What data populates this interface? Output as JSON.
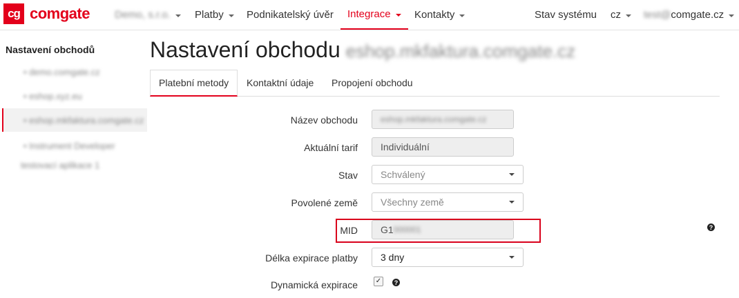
{
  "brand": {
    "logo_mark": "cg",
    "name": "comgate"
  },
  "navbar": {
    "company": "Demo, s.r.o.",
    "items": [
      "Platby",
      "Podnikatelský úvěr",
      "Integrace",
      "Kontakty"
    ],
    "active": "Integrace",
    "status": "Stav systému",
    "language": "cz",
    "user_prefix": "test@",
    "user_domain": "comgate.cz"
  },
  "sidebar": {
    "title": "Nastavení obchodů",
    "items": [
      "• demo.comgate.cz",
      "• eshop.xyz.eu",
      "• eshop.mkfaktura.comgate.cz",
      "• Instrument Developer",
      "  testovací aplikace 1"
    ]
  },
  "page": {
    "title": "Nastavení obchodu",
    "title_suffix": "eshop.mkfaktura.comgate.cz"
  },
  "tabs": [
    "Platební metody",
    "Kontaktní údaje",
    "Propojení obchodu"
  ],
  "form": {
    "shop_name_label": "Název obchodu",
    "shop_name_value": "eshop.mkfaktura.comgate.cz",
    "tariff_label": "Aktuální tarif",
    "tariff_value": "Individuální",
    "state_label": "Stav",
    "state_value": "Schválený",
    "countries_label": "Povolené země",
    "countries_value": "Všechny země",
    "mid_label": "MID",
    "mid_prefix": "G1",
    "mid_hidden": "000001",
    "expiry_label": "Délka expirace platby",
    "expiry_value": "3 dny",
    "dynamic_label": "Dynamická expirace",
    "dynamic_checked": "✓",
    "help_glyph": "?"
  },
  "colors": {
    "accent": "#e3001b"
  }
}
